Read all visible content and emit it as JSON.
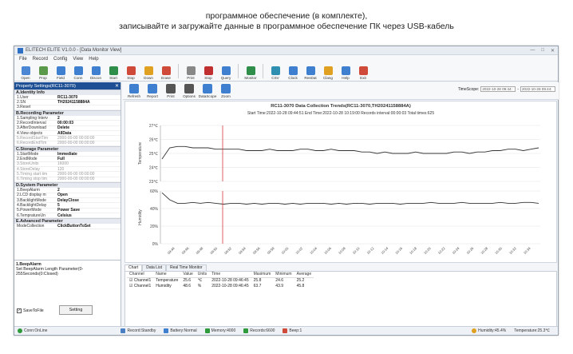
{
  "caption": {
    "line1": "программное обеспечение (в комплекте),",
    "line2": "записывайте и загружайте данные в программное обеспечение ПК через USB-кабель"
  },
  "window": {
    "title": "ELITECH ELITE V1.0.0 - [Data Monitor View]"
  },
  "menu": [
    "File",
    "Record",
    "Config",
    "View",
    "Help"
  ],
  "toolbar": [
    {
      "label": "Open",
      "icon": "folder-icon",
      "color": "#4a86d4"
    },
    {
      "label": "Prop",
      "icon": "properties-icon",
      "color": "#5a9a4a"
    },
    {
      "label": "Field",
      "icon": "field-icon",
      "color": "#3f7fcf"
    },
    {
      "label": "Conn",
      "icon": "connect-icon",
      "color": "#3f7fcf"
    },
    {
      "label": "Discon",
      "icon": "disconnect-icon",
      "color": "#3f7fcf"
    },
    {
      "label": "Start",
      "icon": "start-icon",
      "color": "#2f8f4a"
    },
    {
      "label": "Stop",
      "icon": "stop-icon",
      "color": "#d04a3a"
    },
    {
      "label": "Down",
      "icon": "download-icon",
      "color": "#e0a020"
    },
    {
      "label": "Erase",
      "icon": "erase-icon",
      "color": "#d04a3a"
    },
    {
      "label": "Print",
      "icon": "print-icon",
      "color": "#888888"
    },
    {
      "label": "Stop",
      "icon": "stop2-icon",
      "color": "#c03030"
    },
    {
      "label": "Query",
      "icon": "query-icon",
      "color": "#3f7fcf"
    },
    {
      "label": "Monitor",
      "icon": "monitor-icon",
      "color": "#2f8f4a"
    },
    {
      "label": "CSV",
      "icon": "csv-icon",
      "color": "#2f8fb0"
    },
    {
      "label": "Clock",
      "icon": "clock-icon",
      "color": "#3f7fcf"
    },
    {
      "label": "ResDat",
      "icon": "reset-icon",
      "color": "#3f7fcf"
    },
    {
      "label": "Clang",
      "icon": "language-icon",
      "color": "#e0a020"
    },
    {
      "label": "Help",
      "icon": "help-icon",
      "color": "#3f7fcf"
    },
    {
      "label": "Exit",
      "icon": "exit-icon",
      "color": "#d04a3a"
    }
  ],
  "left": {
    "header": "Property Settings(RC11-3070)",
    "sections": [
      {
        "title": "A.Identity Info",
        "rows": [
          {
            "k": "1.User",
            "v": "RC11-3070",
            "dim": false
          },
          {
            "k": "2.SN",
            "v": "TH20241158884A",
            "dim": false
          },
          {
            "k": "3.Reset",
            "v": "",
            "dim": false
          }
        ]
      },
      {
        "title": "B.Recording Parameter",
        "rows": [
          {
            "k": "1.Sampling Interv",
            "v": "2",
            "dim": false
          },
          {
            "k": "2.RecordInterval",
            "v": "00:00:03",
            "dim": false
          },
          {
            "k": "3.AfterDownload",
            "v": "Delete",
            "dim": false
          },
          {
            "k": "4.View objects",
            "v": "AllData",
            "dim": false
          },
          {
            "k": "5.RecordStartTim",
            "v": "2000-00-00 00:00:00",
            "dim": true
          },
          {
            "k": "6.RecordEndTim",
            "v": "2000-00-00 00:00:00",
            "dim": true
          }
        ]
      },
      {
        "title": "C.Storage Parameter",
        "rows": [
          {
            "k": "1.StartMode",
            "v": "Immediate",
            "dim": false
          },
          {
            "k": "2.EndMode",
            "v": "Full",
            "dim": false
          },
          {
            "k": "3.StoreUnits",
            "v": "16000",
            "dim": true
          },
          {
            "k": "4.StoreDelay",
            "v": "120",
            "dim": true
          },
          {
            "k": "5.Timing start tim",
            "v": "2000-00-00 00:00:00",
            "dim": true
          },
          {
            "k": "6.Timing stop tim",
            "v": "2000-00-00 00:00:00",
            "dim": true
          }
        ]
      },
      {
        "title": "D.System Parameter",
        "rows": [
          {
            "k": "1.BeepAlarm",
            "v": "2",
            "dim": false
          },
          {
            "k": "2.LCD display m",
            "v": "Open",
            "dim": false
          },
          {
            "k": "3.BacklightMode",
            "v": "DelayClose",
            "dim": false
          },
          {
            "k": "4.BacklightDelay",
            "v": "5",
            "dim": false
          },
          {
            "k": "5.PowerMode",
            "v": "Power Save",
            "dim": false
          },
          {
            "k": "6.TempratureUn",
            "v": "Celsius",
            "dim": false
          }
        ]
      },
      {
        "title": "E.Advanced Parameter",
        "rows": [
          {
            "k": "ModeCollection",
            "v": "ClickButtonToSet",
            "dim": false
          }
        ]
      }
    ],
    "desc_title": "1.BeepAlarm",
    "desc_text": "Set BeepAlarm Length Parameter(0-255Seconds(0:Closed)",
    "sync_label": "SaveToFile",
    "setting_button": "Setting"
  },
  "right": {
    "toolbar": [
      {
        "label": "Refresh",
        "icon": "refresh-icon",
        "color": "#3f7fcf"
      },
      {
        "label": "Report",
        "icon": "report-icon",
        "color": "#3f7fcf"
      },
      {
        "label": "Print",
        "icon": "print-icon",
        "color": "#555555"
      },
      {
        "label": "Options",
        "icon": "options-icon",
        "color": "#555555"
      },
      {
        "label": "DataScope",
        "icon": "datascope-icon",
        "color": "#3f7fcf"
      },
      {
        "label": "Zoom",
        "icon": "zoom-icon",
        "color": "#3f7fcf"
      }
    ],
    "range_label": "TimeScope:",
    "range_from": "2022-10-28 09:44:",
    "range_to": "2022-10-28 09:44:"
  },
  "chart_data": [
    {
      "type": "line",
      "title": "RC11-3070 Data Collection Trends(RC11-3070,TH20241158884A)",
      "info": "Start Time:2022-10-28 09:44:51   End Time:2022-10-28 10:19:00   Records interval:00:00:03   Total times:625",
      "ylabel": "Temperature",
      "yticks": [
        "27℃",
        "26℃",
        "25℃",
        "24℃",
        "23℃"
      ],
      "ylim": [
        23,
        27
      ],
      "series": [
        {
          "values": [
            24.6,
            25.4,
            25.5,
            25.5,
            25.4,
            25.4,
            25.4,
            25.3,
            25.3,
            25.3,
            25.3,
            25.2,
            25.2,
            25.2,
            25.3,
            25.2,
            25.2,
            25.2,
            25.3,
            25.3,
            25.2,
            25.2,
            25.3,
            25.2,
            25.2,
            25.2,
            25.1,
            25.1,
            25.0,
            25.1,
            25.0,
            25.0,
            25.0,
            25.1,
            25.0,
            25.0,
            25.0,
            25.0,
            25.1,
            25.1,
            25.0,
            25.1,
            25.1,
            25.2,
            25.2,
            25.3,
            25.3,
            25.2,
            25.3,
            25.4
          ],
          "color": "#333333"
        }
      ]
    },
    {
      "type": "line",
      "ylabel": "Humidity",
      "yticks": [
        "60%",
        "40%",
        "20%",
        "0%"
      ],
      "ylim": [
        0,
        60
      ],
      "xticks": [
        "09:44",
        "09:46",
        "09:48",
        "09:50",
        "09:52",
        "09:54",
        "09:56",
        "09:58",
        "10:00",
        "10:02",
        "10:04",
        "10:06",
        "10:08",
        "10:10",
        "10:12",
        "10:14",
        "10:16",
        "10:18",
        "10:20",
        "10:22",
        "10:24",
        "10:26",
        "10:28",
        "10:30",
        "10:32",
        "10:34"
      ],
      "series": [
        {
          "values": [
            58,
            50,
            46,
            46,
            47,
            46,
            47,
            46,
            45,
            46,
            46,
            45,
            46,
            45,
            46,
            46,
            45,
            46,
            45,
            46,
            46,
            46,
            45,
            46,
            45,
            46,
            46,
            45,
            46,
            46,
            46,
            45,
            46,
            46,
            46,
            47,
            46,
            46,
            46,
            47,
            46,
            46,
            46,
            46,
            47,
            46,
            46,
            47,
            47,
            46
          ],
          "color": "#333333"
        }
      ]
    }
  ],
  "tabs": [
    "Chart",
    "Data List",
    "Real Time Monitor"
  ],
  "grid": {
    "headers": [
      "Channel",
      "Name",
      "Value",
      "Units",
      "Time",
      "Maximum",
      "Minimum",
      "Average"
    ],
    "rows": [
      [
        "Channel1",
        "Temperature",
        "25.6",
        "℃",
        "2022-10-28 09:46:45",
        "25.8",
        "24.6",
        "25.2"
      ],
      [
        "Channel1",
        "Humidity",
        "48.6",
        "%",
        "2022-10-28 09:46:45",
        "63.7",
        "43.9",
        "45.8"
      ]
    ]
  },
  "status": {
    "conn": "Conn:OnLine",
    "items": [
      "Record:Standby",
      "Battery:Normal",
      "Memory:4000",
      "Records:6600",
      "Beep:1"
    ],
    "humidity": "Humidity:45.4%",
    "temperature": "Temperature:25.3℃"
  }
}
